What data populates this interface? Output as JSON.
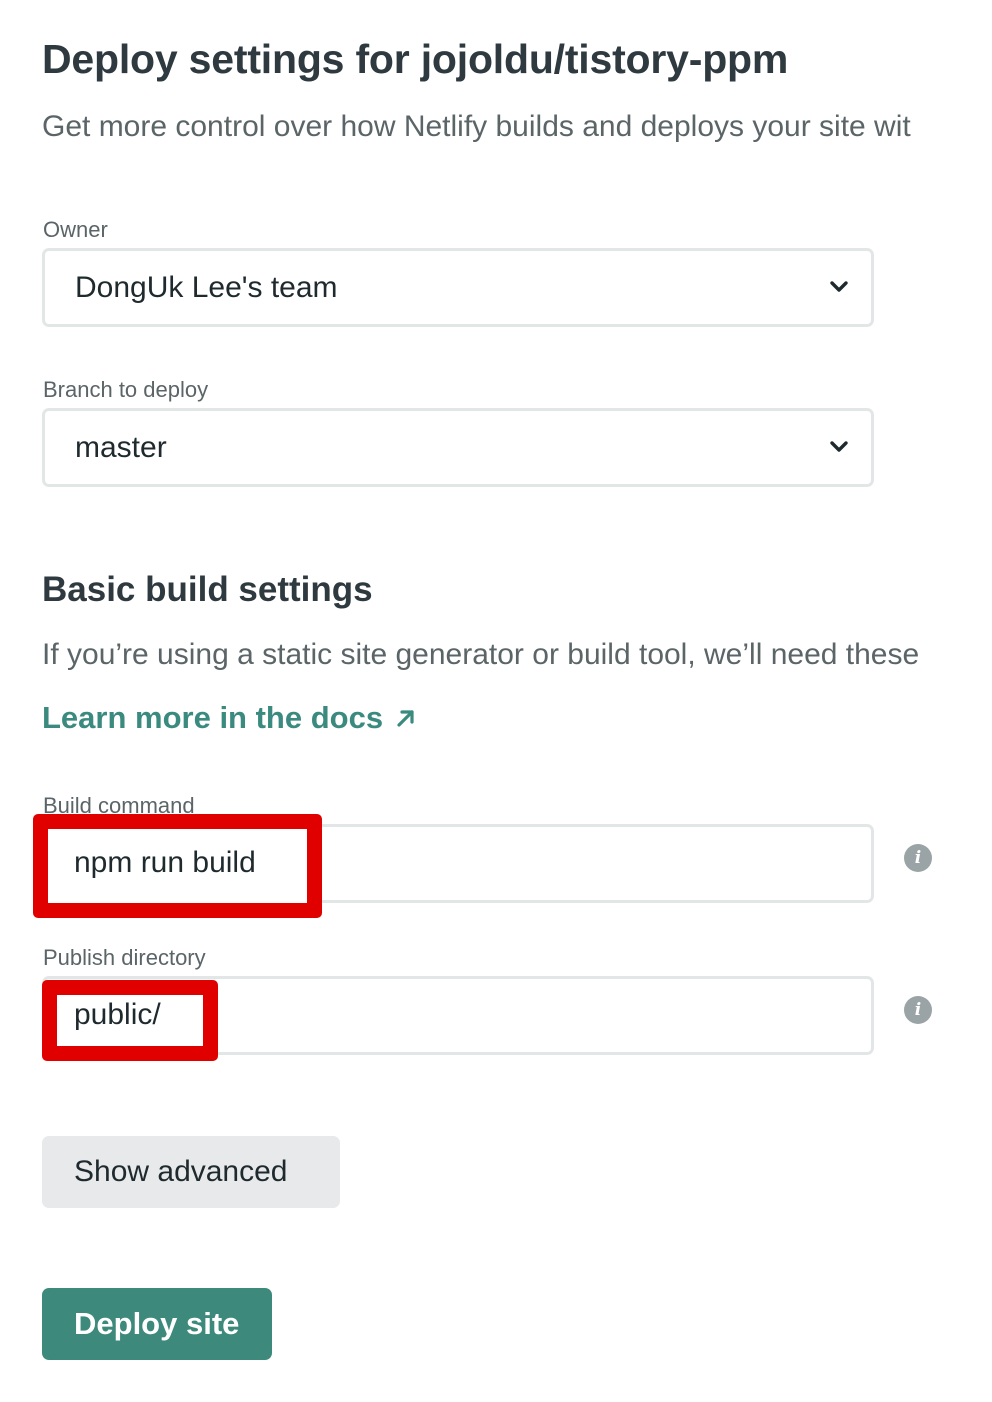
{
  "header": {
    "title": "Deploy settings for jojoldu/tistory-ppm",
    "subtitle": "Get more control over how Netlify builds and deploys your site wit"
  },
  "owner": {
    "label": "Owner",
    "value": "DongUk Lee's team"
  },
  "branch": {
    "label": "Branch to deploy",
    "value": "master"
  },
  "build_settings": {
    "title": "Basic build settings",
    "description": "If you’re using a static site generator or build tool, we’ll need these",
    "docs_link": "Learn more in the docs"
  },
  "build_command": {
    "label": "Build command",
    "value": "npm run build"
  },
  "publish_directory": {
    "label": "Publish directory",
    "value": "public/"
  },
  "buttons": {
    "show_advanced": "Show advanced",
    "deploy": "Deploy site"
  },
  "colors": {
    "accent": "#3d8a7d",
    "highlight": "#e00000",
    "link": "#3a8a7f"
  }
}
